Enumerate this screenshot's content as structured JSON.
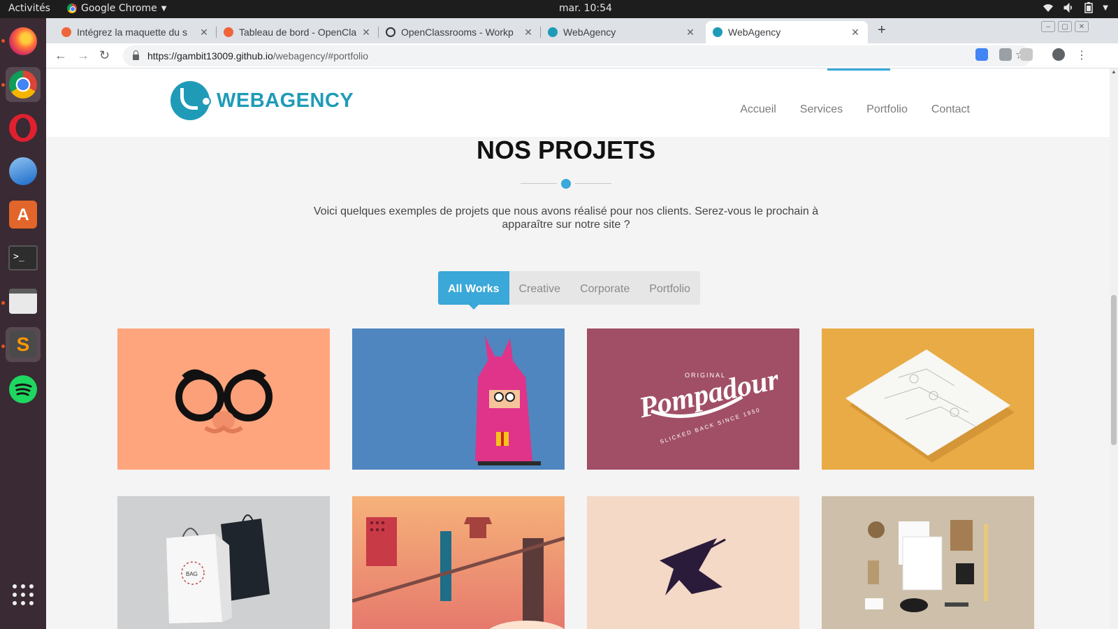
{
  "os": {
    "activities": "Activités",
    "app_name": "Google Chrome",
    "clock": "mar. 10:54"
  },
  "tabs": [
    {
      "title": "Intégrez la maquette du s"
    },
    {
      "title": "Tableau de bord - OpenCla"
    },
    {
      "title": "OpenClassrooms - Workp"
    },
    {
      "title": "WebAgency"
    },
    {
      "title": "WebAgency"
    }
  ],
  "address": {
    "host": "https://gambit13009.github.io",
    "path": "/webagency/#portfolio"
  },
  "site": {
    "logo_text": "WEBAGENCY",
    "nav": [
      "Accueil",
      "Services",
      "Portfolio",
      "Contact"
    ],
    "section_title": "NOS PROJETS",
    "intro_line1": "Voici quelques exemples de projets que nous avons réalisé pour nos clients. Serez-vous le prochain à",
    "intro_line2": "apparaître sur notre site ?",
    "filters": [
      "All Works",
      "Creative",
      "Corporate",
      "Portfolio"
    ],
    "accent": "#3aa8d8",
    "thumb_text": {
      "original": "ORIGINAL",
      "pompadour": "Pompadour",
      "slicked": "SLICKED BACK SINCE 1950",
      "bag": "BAG"
    }
  }
}
